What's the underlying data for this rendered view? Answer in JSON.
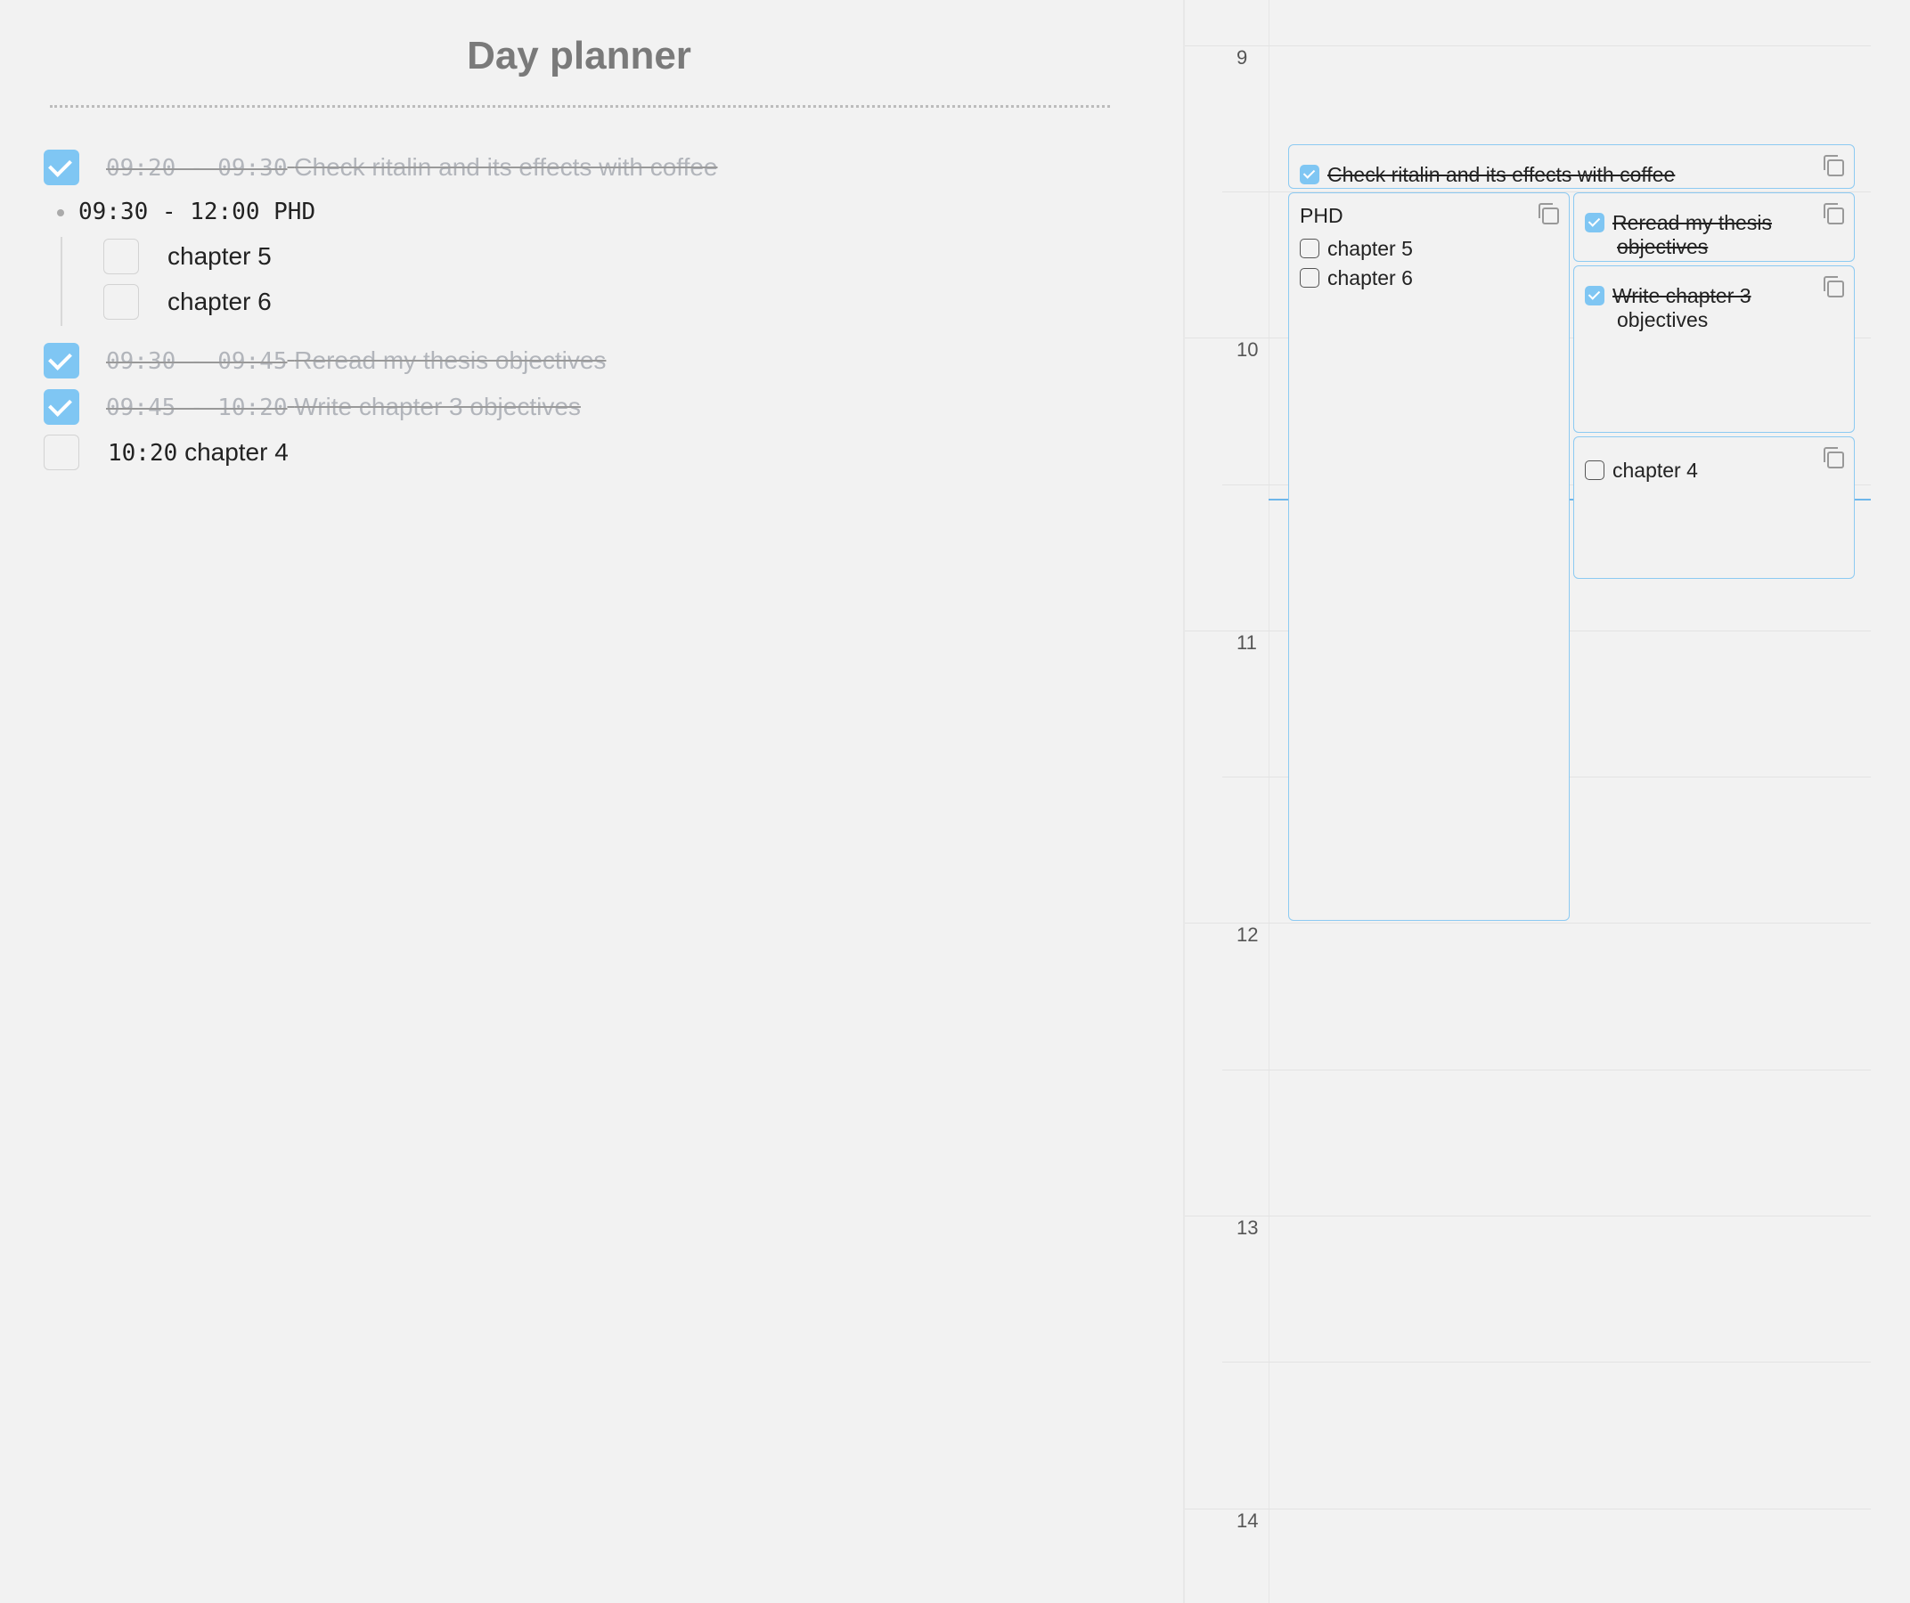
{
  "editor": {
    "title": "Day planner",
    "tasks": [
      {
        "time": "09:20 - 09:30",
        "text": "Check ritalin and its effects with coffee",
        "done": true
      },
      {
        "heading": "09:30 - 12:00 PHD",
        "subtasks": [
          {
            "text": "chapter 5",
            "done": false
          },
          {
            "text": "chapter 6",
            "done": false
          }
        ]
      },
      {
        "time": "09:30 - 09:45",
        "text": "Reread my thesis objectives",
        "done": true
      },
      {
        "time": "09:45 - 10:20",
        "text": "Write chapter 3 objectives",
        "done": true
      },
      {
        "time": "10:20",
        "text": "chapter 4",
        "done": false
      }
    ]
  },
  "timeline": {
    "hours": [
      "9",
      "10",
      "11",
      "12",
      "13",
      "14"
    ],
    "events": {
      "coffee": {
        "text": "Check ritalin and its effects with coffee",
        "done": true
      },
      "phd": {
        "title": "PHD",
        "items": [
          {
            "text": "chapter 5",
            "done": false
          },
          {
            "text": "chapter 6",
            "done": false
          }
        ]
      },
      "reread": {
        "line1": "Reread my thesis",
        "line2": "objectives",
        "done": true
      },
      "write": {
        "line1": "Write chapter 3",
        "line2": "objectives",
        "done": true
      },
      "chapter4": {
        "text": "chapter 4",
        "done": false
      }
    },
    "accent_color": "#7fc6f3",
    "copy_icon": "copy-icon"
  }
}
